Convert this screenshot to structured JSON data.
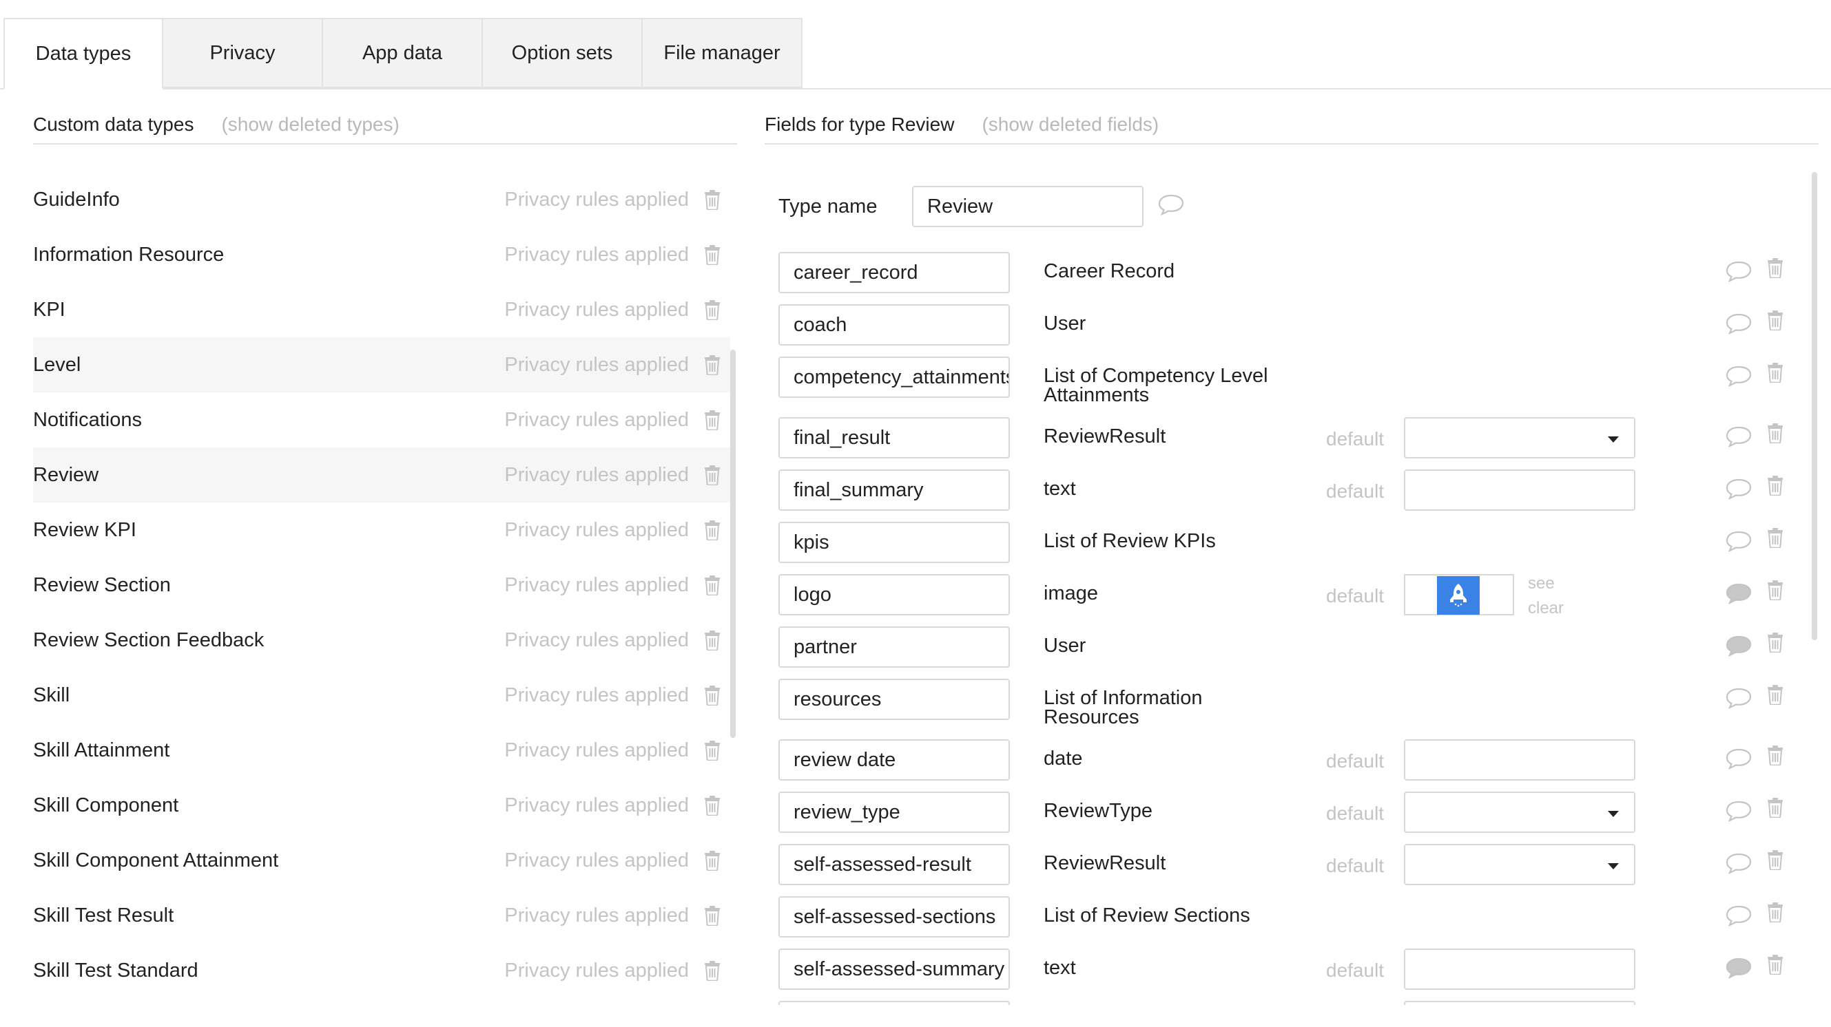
{
  "tabs": [
    {
      "label": "Data types",
      "active": true
    },
    {
      "label": "Privacy",
      "active": false
    },
    {
      "label": "App data",
      "active": false
    },
    {
      "label": "Option sets",
      "active": false
    },
    {
      "label": "File manager",
      "active": false
    }
  ],
  "left": {
    "title": "Custom data types",
    "show_deleted": "(show deleted types)",
    "types": [
      {
        "name": "GuideInfo",
        "privacy": "Privacy rules applied",
        "highlighted": false
      },
      {
        "name": "Information Resource",
        "privacy": "Privacy rules applied",
        "highlighted": false
      },
      {
        "name": "KPI",
        "privacy": "Privacy rules applied",
        "highlighted": false
      },
      {
        "name": "Level",
        "privacy": "Privacy rules applied",
        "highlighted": true
      },
      {
        "name": "Notifications",
        "privacy": "Privacy rules applied",
        "highlighted": false
      },
      {
        "name": "Review",
        "privacy": "Privacy rules applied",
        "highlighted": true
      },
      {
        "name": "Review KPI",
        "privacy": "Privacy rules applied",
        "highlighted": false
      },
      {
        "name": "Review Section",
        "privacy": "Privacy rules applied",
        "highlighted": false
      },
      {
        "name": "Review Section Feedback",
        "privacy": "Privacy rules applied",
        "highlighted": false
      },
      {
        "name": "Skill",
        "privacy": "Privacy rules applied",
        "highlighted": false
      },
      {
        "name": "Skill Attainment",
        "privacy": "Privacy rules applied",
        "highlighted": false
      },
      {
        "name": "Skill Component",
        "privacy": "Privacy rules applied",
        "highlighted": false
      },
      {
        "name": "Skill Component Attainment",
        "privacy": "Privacy rules applied",
        "highlighted": false
      },
      {
        "name": "Skill Test Result",
        "privacy": "Privacy rules applied",
        "highlighted": false
      },
      {
        "name": "Skill Test Standard",
        "privacy": "Privacy rules applied",
        "highlighted": false
      }
    ]
  },
  "right": {
    "title": "Fields for type Review",
    "show_deleted": "(show deleted fields)",
    "type_name_label": "Type name",
    "type_name_value": "Review",
    "default_label": "default",
    "see_label": "see",
    "clear_label": "clear",
    "fields": [
      {
        "name": "career_record",
        "type": "Career Record",
        "kind": "none",
        "comment_filled": false
      },
      {
        "name": "coach",
        "type": "User",
        "kind": "none",
        "comment_filled": false
      },
      {
        "name": "competency_attainments",
        "type": "List of Competency Level Attainments",
        "kind": "none",
        "comment_filled": false
      },
      {
        "name": "final_result",
        "type": "ReviewResult",
        "kind": "select",
        "comment_filled": false
      },
      {
        "name": "final_summary",
        "type": "text",
        "kind": "input",
        "comment_filled": false
      },
      {
        "name": "kpis",
        "type": "List of Review KPIs",
        "kind": "none",
        "comment_filled": false
      },
      {
        "name": "logo",
        "type": "image",
        "kind": "image",
        "comment_filled": true
      },
      {
        "name": "partner",
        "type": "User",
        "kind": "none",
        "comment_filled": true
      },
      {
        "name": "resources",
        "type": "List of Information Resources",
        "kind": "none",
        "comment_filled": false
      },
      {
        "name": "review date",
        "type": "date",
        "kind": "input",
        "comment_filled": false
      },
      {
        "name": "review_type",
        "type": "ReviewType",
        "kind": "select",
        "comment_filled": false
      },
      {
        "name": "self-assessed-result",
        "type": "ReviewResult",
        "kind": "select",
        "comment_filled": false
      },
      {
        "name": "self-assessed-sections",
        "type": "List of Review Sections",
        "kind": "none",
        "comment_filled": false
      },
      {
        "name": "self-assessed-summary",
        "type": "text",
        "kind": "input",
        "comment_filled": true
      },
      {
        "name": "",
        "type": "",
        "kind": "input",
        "comment_filled": false
      }
    ]
  },
  "icons": {
    "trash": "trash-icon",
    "comment": "comment-icon",
    "logo_thumb": "rocket-icon"
  },
  "colors": {
    "thumb_blue": "#3b82e6",
    "muted": "#c4c4c4",
    "border": "#d8d8d8"
  }
}
